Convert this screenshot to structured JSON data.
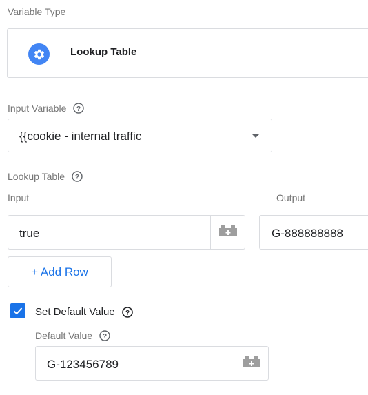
{
  "variable_type": {
    "label": "Variable Type",
    "selected": "Lookup Table",
    "icon": "gear-icon",
    "accent": "#4285f4"
  },
  "input_variable": {
    "label": "Input Variable",
    "value": "{{cookie - internal traffic"
  },
  "lookup_table": {
    "label": "Lookup Table",
    "input_header": "Input",
    "output_header": "Output",
    "rows": [
      {
        "input": "true",
        "output": "G-888888888"
      }
    ],
    "add_row_label": "+ Add Row"
  },
  "default_value": {
    "checkbox_label": "Set Default Value",
    "checked": true,
    "field_label": "Default Value",
    "value": "G-123456789"
  },
  "colors": {
    "checkbox": "#1a73e8",
    "link": "#1a73e8",
    "muted": "#757575"
  }
}
